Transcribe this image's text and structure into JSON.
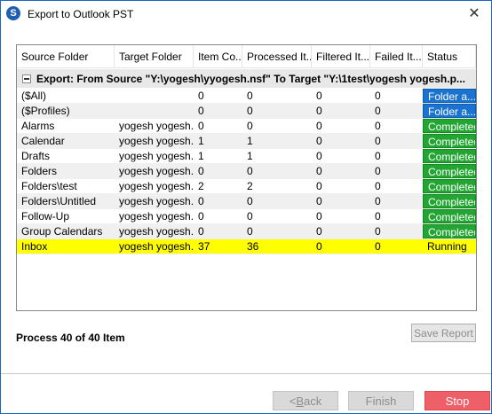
{
  "window": {
    "title": "Export to Outlook PST",
    "app_icon_letter": "S",
    "close_glyph": "✕"
  },
  "grid": {
    "columns": [
      "Source Folder",
      "Target Folder",
      "Item Co...",
      "Processed It...",
      "Filtered It...",
      "Failed It...",
      "Status"
    ],
    "group_label": "Export: From Source \"Y:\\yogesh\\yyogesh.nsf\" To Target \"Y:\\1test\\yogesh yogesh.p...",
    "rows": [
      {
        "source": "($All)",
        "target": "",
        "item_count": "0",
        "processed": "0",
        "filtered": "0",
        "failed": "0",
        "status": "Folder a...",
        "status_kind": "blue"
      },
      {
        "source": "($Profiles)",
        "target": "",
        "item_count": "0",
        "processed": "0",
        "filtered": "0",
        "failed": "0",
        "status": "Folder a...",
        "status_kind": "blue"
      },
      {
        "source": "Alarms",
        "target": "yogesh yogesh...",
        "item_count": "0",
        "processed": "0",
        "filtered": "0",
        "failed": "0",
        "status": "Completed",
        "status_kind": "green"
      },
      {
        "source": "Calendar",
        "target": "yogesh yogesh...",
        "item_count": "1",
        "processed": "1",
        "filtered": "0",
        "failed": "0",
        "status": "Completed",
        "status_kind": "green"
      },
      {
        "source": "Drafts",
        "target": "yogesh yogesh...",
        "item_count": "1",
        "processed": "1",
        "filtered": "0",
        "failed": "0",
        "status": "Completed",
        "status_kind": "green"
      },
      {
        "source": "Folders",
        "target": "yogesh yogesh...",
        "item_count": "0",
        "processed": "0",
        "filtered": "0",
        "failed": "0",
        "status": "Completed",
        "status_kind": "green"
      },
      {
        "source": "Folders\\test",
        "target": "yogesh yogesh...",
        "item_count": "2",
        "processed": "2",
        "filtered": "0",
        "failed": "0",
        "status": "Completed",
        "status_kind": "green"
      },
      {
        "source": "Folders\\Untitled",
        "target": "yogesh yogesh...",
        "item_count": "0",
        "processed": "0",
        "filtered": "0",
        "failed": "0",
        "status": "Completed",
        "status_kind": "green"
      },
      {
        "source": "Follow-Up",
        "target": "yogesh yogesh...",
        "item_count": "0",
        "processed": "0",
        "filtered": "0",
        "failed": "0",
        "status": "Completed",
        "status_kind": "green"
      },
      {
        "source": "Group Calendars",
        "target": "yogesh yogesh...",
        "item_count": "0",
        "processed": "0",
        "filtered": "0",
        "failed": "0",
        "status": "Completed",
        "status_kind": "green"
      },
      {
        "source": "Inbox",
        "target": "yogesh yogesh...",
        "item_count": "37",
        "processed": "36",
        "filtered": "0",
        "failed": "0",
        "status": "Running",
        "status_kind": "running"
      }
    ]
  },
  "progress_text": "Process 40 of 40 Item",
  "buttons": {
    "save_report": "Save Report",
    "back_prefix": "< ",
    "back_underlined": "B",
    "back_rest": "ack",
    "finish": "Finish",
    "stop": "Stop"
  },
  "colors": {
    "status_blue": "#1a73d1",
    "status_green": "#22a532",
    "selected_row": "#ffff00",
    "stop_button": "#ee5f67"
  }
}
